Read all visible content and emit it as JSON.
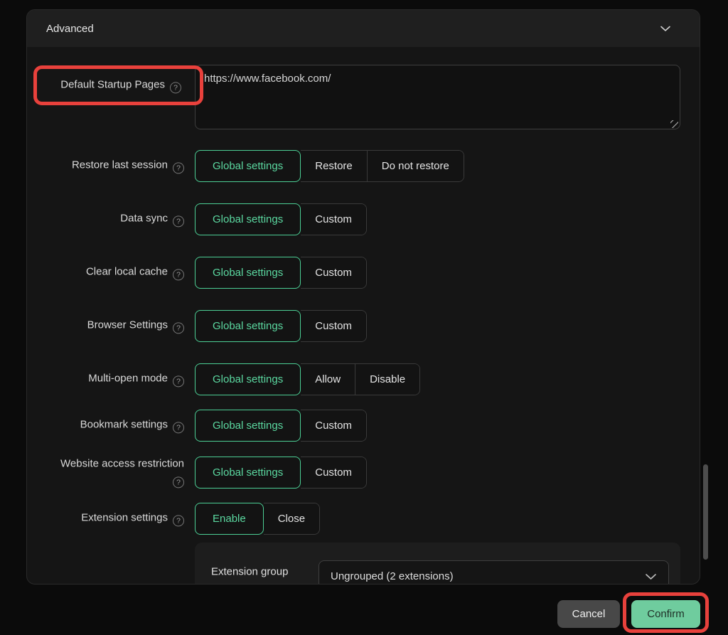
{
  "colors": {
    "accent_green": "#4ccf95",
    "accent_green_text": "#5bd8a0",
    "confirm_button_bg": "#6fcc9e",
    "annotation_red": "#e8413c"
  },
  "icons": {
    "header_collapse": "chevron-down-icon",
    "help": "question-circle-icon",
    "dropdown": "chevron-down-icon",
    "textarea_resize": "resize-handle-icon"
  },
  "panel": {
    "title": "Advanced"
  },
  "startup": {
    "label": "Default Startup Pages",
    "value": "https://www.facebook.com/"
  },
  "settings": [
    {
      "id": "restore-last-session",
      "label": "Restore last session",
      "options": [
        "Global settings",
        "Restore",
        "Do not restore"
      ],
      "selected": "Global settings"
    },
    {
      "id": "data-sync",
      "label": "Data sync",
      "options": [
        "Global settings",
        "Custom"
      ],
      "selected": "Global settings"
    },
    {
      "id": "clear-local-cache",
      "label": "Clear local cache",
      "options": [
        "Global settings",
        "Custom"
      ],
      "selected": "Global settings"
    },
    {
      "id": "browser-settings",
      "label": "Browser Settings",
      "options": [
        "Global settings",
        "Custom"
      ],
      "selected": "Global settings"
    },
    {
      "id": "multi-open-mode",
      "label": "Multi-open mode",
      "options": [
        "Global settings",
        "Allow",
        "Disable"
      ],
      "selected": "Global settings"
    },
    {
      "id": "bookmark-settings",
      "label": "Bookmark settings",
      "options": [
        "Global settings",
        "Custom"
      ],
      "selected": "Global settings"
    },
    {
      "id": "website-access-restriction",
      "label": "Website access restriction",
      "options": [
        "Global settings",
        "Custom"
      ],
      "selected": "Global settings"
    },
    {
      "id": "extension-settings",
      "label": "Extension settings",
      "options": [
        "Enable",
        "Close"
      ],
      "selected": "Enable"
    }
  ],
  "extension_group": {
    "label": "Extension group",
    "value": "Ungrouped (2 extensions)"
  },
  "footer": {
    "cancel": "Cancel",
    "confirm": "Confirm"
  }
}
